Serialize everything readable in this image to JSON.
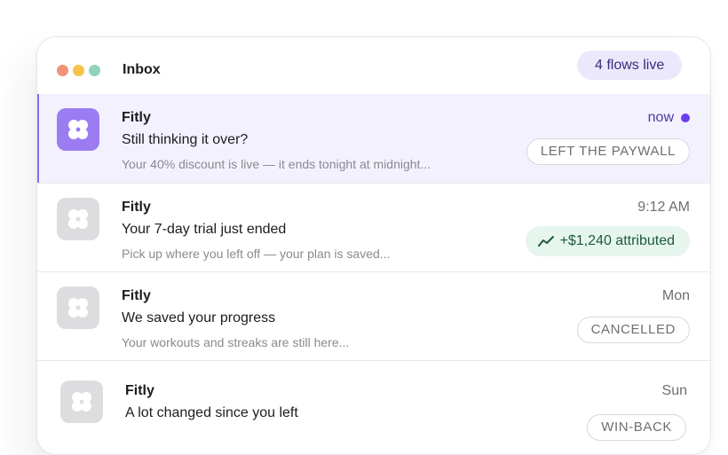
{
  "header": {
    "title": "Inbox",
    "flows_badge": "4 flows live",
    "window_dots": [
      "#f0937a",
      "#f5c24a",
      "#8fd3b8"
    ]
  },
  "accent": "#8b6cf0",
  "messages": [
    {
      "sender": "Fitly",
      "subject": "Still thinking it over?",
      "preview": "Your 40% discount is live — it ends tonight at midnight...",
      "time": "now",
      "unread": true,
      "tag": "LEFT THE PAYWALL"
    },
    {
      "sender": "Fitly",
      "subject": "Your 7-day trial just ended",
      "preview": "Pick up where you left off — your plan is saved...",
      "time": "9:12 AM",
      "attribution": "+$1,240 attributed",
      "attribution_icon": "trending-up-icon"
    },
    {
      "sender": "Fitly",
      "subject": "We saved your progress",
      "preview": "Your workouts and streaks are still here...",
      "time": "Mon",
      "tag": "CANCELLED"
    },
    {
      "sender": "Fitly",
      "subject": "A lot changed since you left",
      "time": "Sun",
      "tag": "WIN-BACK"
    }
  ]
}
